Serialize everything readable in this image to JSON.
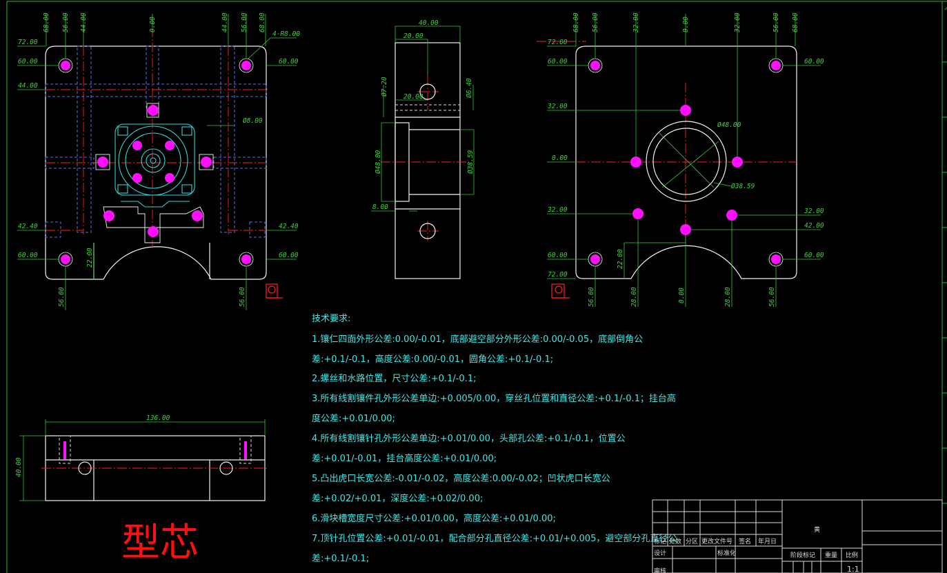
{
  "colors": {
    "background": "#000000",
    "outline": "#f2f2f2",
    "dimension": "#3fd23f",
    "centerline": "#ff2020",
    "hidden": "#5a6fe8",
    "note": "#42e8e8",
    "hole": "#ff10ff",
    "title": "#ff1010"
  },
  "view1": {
    "top_dims": [
      "68.00",
      "56.00",
      "44.00",
      "0.00",
      "44.00",
      "56.00",
      "68.00"
    ],
    "left_dims": [
      "72.00",
      "60.00",
      "44.00",
      "42.40",
      "60.00"
    ],
    "right_dims": [
      "60.00",
      "42.40",
      "60.00"
    ],
    "hole_label": "4-R8.00",
    "dia_label": "Ø8.00",
    "height_label": "22.00",
    "bottom_dims": [
      "56.00",
      "56.00"
    ]
  },
  "view2": {
    "width": "40.00",
    "half": "20.00",
    "inner": "20.00",
    "dia1": "Ø7.20",
    "dia2": "Ø6.40",
    "dia3": "Ø48.00",
    "dia4": "Ø38.59",
    "step": "8.00"
  },
  "view3": {
    "top_dims": [
      "68.00",
      "56.00",
      "32.00",
      "0.00",
      "32.00",
      "56.00",
      "68.00"
    ],
    "left_dims": [
      "72.00",
      "60.00",
      "32.00",
      "0.00",
      "32.00",
      "60.00",
      "72.00"
    ],
    "right_dims": [
      "60.00",
      "32.00",
      "42.00",
      "60.00"
    ],
    "dia_outer": "Ø48.00",
    "dia_inner": "Ø38.59",
    "height_label": "22.00",
    "bottom_dims": [
      "56.00",
      "28.00",
      "0.00",
      "28.00",
      "56.00"
    ]
  },
  "view4": {
    "width": "136.00",
    "height": "40.00"
  },
  "notes": {
    "heading": "技术要求:",
    "lines": [
      "1.镶仁四面外形公差:0.00/-0.01，底部避空部分外形公差:0.00/-0.05，底部倒角公",
      "差:+0.1/-0.1，高度公差:0.00/-0.01，圆角公差:+0.1/-0.1;",
      "  2.螺丝和水路位置，尺寸公差:+0.1/-0.1;",
      "  3.所有线割镶件孔外形公差单边:+0.005/0.00，穿丝孔位置和直径公差:+0.1/-0.1；挂台高",
      "度公差:+0.01/0.00;",
      "  4.所有线割镶针孔外形公差单边:+0.01/0.00，头部孔公差:+0.1/-0.1，位置公",
      "差:+0.01/-0.01，挂台高度公差:+0.01/0.00;",
      "  5.凸出虎口长宽公差:-0.01/-0.02，高度公差:0.00/-0.02；凹状虎口长宽公",
      "差:+0.02/+0.01，深度公差:+0.02/0.00;",
      "  6.滑块槽宽度尺寸公差:+0.01/0.00，高度公差:+0.01/0.00;",
      "  7.顶针孔位置公差:+0.01/-0.01，配合部分孔直径公差:+0.01/+0.005，避空部分孔直径公",
      "差:+0.1/-0.1;"
    ]
  },
  "title_block": {
    "header": [
      "标记",
      "处数",
      "分区",
      "更改文件号",
      "签名",
      "年月日"
    ],
    "row2": [
      "设计",
      "",
      "标准化"
    ],
    "row3": [
      "审核"
    ],
    "material": "黄",
    "right_labels": [
      "阶段标记",
      "重量",
      "比例"
    ],
    "scale": "1:1"
  },
  "part_title": "型芯"
}
